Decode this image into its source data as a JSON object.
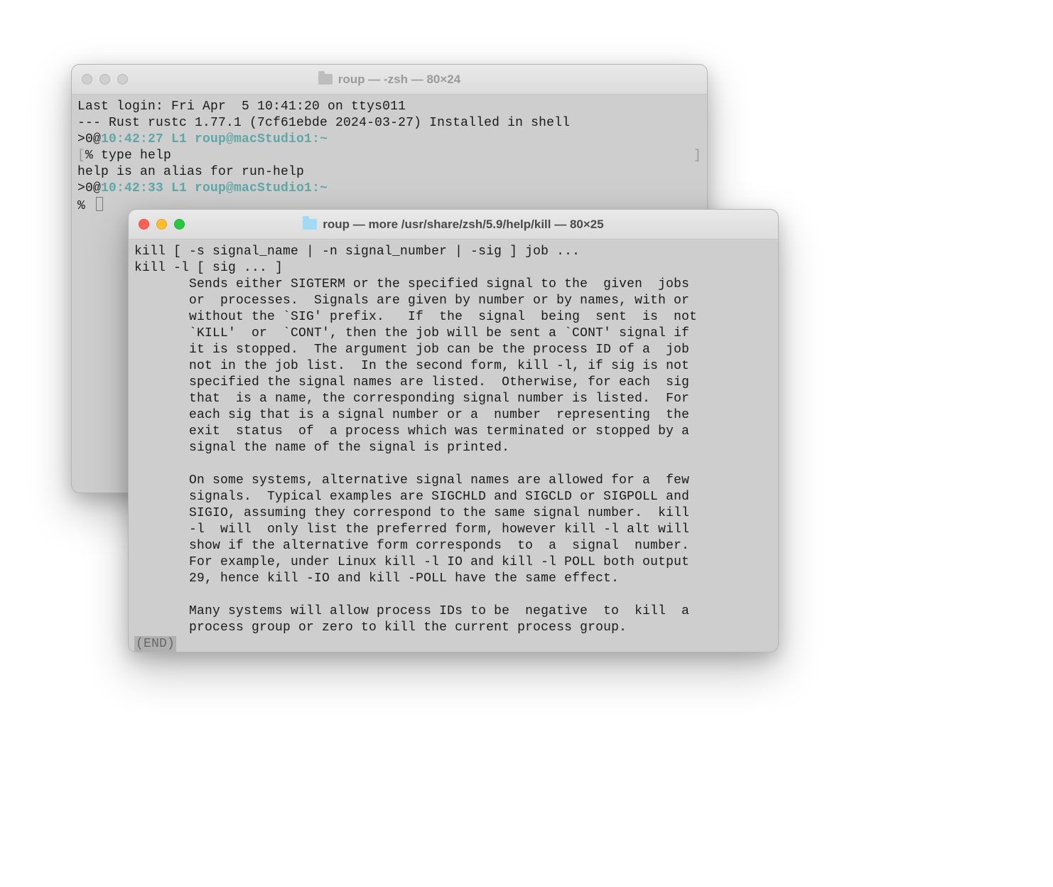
{
  "back": {
    "title": "roup — -zsh — 80×24",
    "lines": {
      "l1": "Last login: Fri Apr  5 10:41:20 on ttys011",
      "l2": "--- Rust rustc 1.77.1 (7cf61ebde 2024-03-27) Installed in shell",
      "l3a": ">0@",
      "l3b": "10:42:27 L1 roup@macStudio1:~",
      "l4a": "[",
      "l4b": "% type help",
      "l4c": "]",
      "l5": "help is an alias for run-help",
      "l6a": ">0@",
      "l6b": "10:42:33 L1 roup@macStudio1:~",
      "l7": "% "
    }
  },
  "front": {
    "title": "roup — more /usr/share/zsh/5.9/help/kill — 80×25",
    "body": "kill [ -s signal_name | -n signal_number | -sig ] job ...\nkill -l [ sig ... ]\n       Sends either SIGTERM or the specified signal to the  given  jobs\n       or  processes.  Signals are given by number or by names, with or\n       without the `SIG' prefix.   If  the  signal  being  sent  is  not\n       `KILL'  or  `CONT', then the job will be sent a `CONT' signal if\n       it is stopped.  The argument job can be the process ID of a  job\n       not in the job list.  In the second form, kill -l, if sig is not\n       specified the signal names are listed.  Otherwise, for each  sig\n       that  is a name, the corresponding signal number is listed.  For\n       each sig that is a signal number or a  number  representing  the\n       exit  status  of  a process which was terminated or stopped by a\n       signal the name of the signal is printed.\n\n       On some systems, alternative signal names are allowed for a  few\n       signals.  Typical examples are SIGCHLD and SIGCLD or SIGPOLL and\n       SIGIO, assuming they correspond to the same signal number.  kill\n       -l  will  only list the preferred form, however kill -l alt will\n       show if the alternative form corresponds  to  a  signal  number.\n       For example, under Linux kill -l IO and kill -l POLL both output\n       29, hence kill -IO and kill -POLL have the same effect.\n\n       Many systems will allow process IDs to be  negative  to  kill  a\n       process group or zero to kill the current process group.",
    "end": "(END)"
  }
}
